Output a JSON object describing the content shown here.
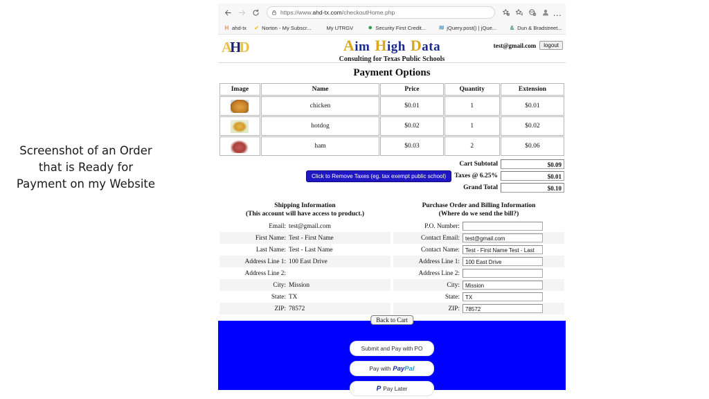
{
  "caption": "Screenshot of an Order that is Ready for Payment on my Website",
  "browser": {
    "back_icon": "back-arrow-icon",
    "forward_icon": "forward-arrow-icon",
    "reload_icon": "reload-icon",
    "lock_icon": "lock-icon",
    "url_prefix": "https://www.",
    "url_domain": "ahd-tx.com",
    "url_path": "/checkoutHome.php",
    "url_full": "https://www.ahd-tx.com/checkoutHome.php",
    "toolbar_icons": [
      "collections-icon",
      "favorites-icon",
      "browser-essentials-icon",
      "profile-avatar-icon"
    ],
    "menu_label": "…",
    "bookmarks": [
      {
        "label": "ahd-tx",
        "favicon": "H",
        "favicon_color": "#d9a61f"
      },
      {
        "label": "Norton - My Subscr...",
        "favicon": "✔",
        "favicon_color": "#e8c43a"
      },
      {
        "label": "My UTRGV",
        "favicon": "",
        "favicon_color": "#888888"
      },
      {
        "label": "Security First Credit...",
        "favicon": "●",
        "favicon_color": "#2e9e4f"
      },
      {
        "label": "jQuery.post() | jQue...",
        "favicon": "≋",
        "favicon_color": "#5d9cc0"
      },
      {
        "label": "Dun & Bradstreet...",
        "favicon": "&",
        "favicon_color": "#2f8f7e"
      }
    ],
    "bookmarks_overflow": "›"
  },
  "site": {
    "logo_text": "AHD",
    "brand": [
      {
        "cap": "A",
        "rest": "im"
      },
      {
        "cap": "H",
        "rest": "igh"
      },
      {
        "cap": "D",
        "rest": "ata"
      }
    ],
    "tagline": "Consulting for Texas Public Schools",
    "account_email": "test@gmail.com",
    "logout_label": "logout"
  },
  "payment_options": {
    "title": "Payment Options",
    "columns": [
      "Image",
      "Name",
      "Price",
      "Quantity",
      "Extension"
    ],
    "rows": [
      {
        "image": "chicken-thumbnail",
        "name": "chicken",
        "price": "$0.01",
        "quantity": "1",
        "extension": "$0.01"
      },
      {
        "image": "hotdog-thumbnail",
        "name": "hotdog",
        "price": "$0.02",
        "quantity": "1",
        "extension": "$0.02"
      },
      {
        "image": "ham-thumbnail",
        "name": "ham",
        "price": "$0.03",
        "quantity": "2",
        "extension": "$0.06"
      }
    ]
  },
  "totals": {
    "remove_taxes_label": "Click to Remove Taxes (eg. tax exempt public school)",
    "remove_taxes_bg": "#2116c4",
    "rows": [
      {
        "label": "Cart Subtotal",
        "value": "$0.09"
      },
      {
        "label": "Taxes @ 6.25%",
        "value": "$0.01"
      },
      {
        "label": "Grand Total",
        "value": "$0.10"
      }
    ]
  },
  "shipping": {
    "title": "Shipping Information",
    "subtitle": "(This account will have access to product.)",
    "fields": [
      {
        "label": "Email:",
        "value": "test@gmail.com"
      },
      {
        "label": "First Name:",
        "value": "Test - First Name"
      },
      {
        "label": "Last Name:",
        "value": "Test - Last Name"
      },
      {
        "label": "Address Line 1:",
        "value": "100 East Drive"
      },
      {
        "label": "Address Line 2:",
        "value": ""
      },
      {
        "label": "City:",
        "value": "Mission"
      },
      {
        "label": "State:",
        "value": "TX"
      },
      {
        "label": "ZIP:",
        "value": "78572"
      }
    ]
  },
  "billing": {
    "title": "Purchase Order and Billing Information",
    "subtitle": "(Where do we send the bill?)",
    "fields": [
      {
        "label": "P.O. Number:",
        "value": ""
      },
      {
        "label": "Contact Email:",
        "value": "test@gmail.com"
      },
      {
        "label": "Contact Name:",
        "value": "Test - First Name Test - Last"
      },
      {
        "label": "Address Line 1:",
        "value": "100 East Drive"
      },
      {
        "label": "Address Line 2:",
        "value": ""
      },
      {
        "label": "City:",
        "value": "Mission"
      },
      {
        "label": "State:",
        "value": "TX"
      },
      {
        "label": "ZIP:",
        "value": "78572"
      }
    ]
  },
  "footer": {
    "bg_color": "#0000ff",
    "back_to_cart": "Back to Cart",
    "submit_po": "Submit and Pay with PO",
    "paypal_prefix": "Pay with",
    "paypal_pay": "Pay",
    "paypal_pal": "Pal",
    "pay_later": "Pay Later"
  }
}
